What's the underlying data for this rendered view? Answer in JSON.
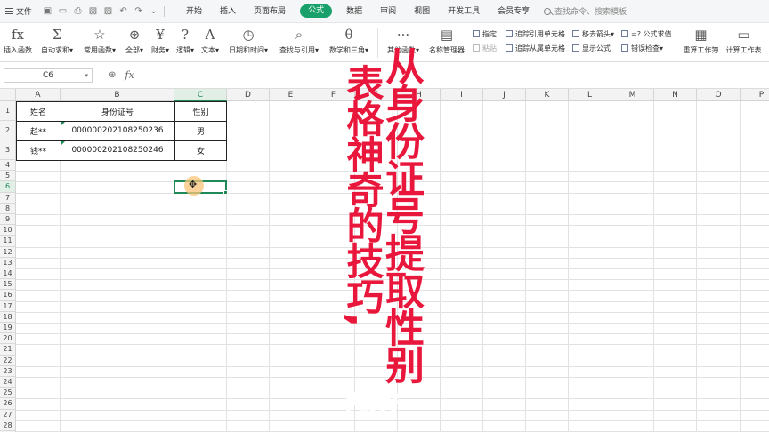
{
  "menu": {
    "file_label": "文件",
    "tabs": [
      "开始",
      "插入",
      "页面布局",
      "公式",
      "数据",
      "审阅",
      "视图",
      "开发工具",
      "会员专享"
    ],
    "active_tab": "公式",
    "search_placeholder": "查找命令、搜索模板"
  },
  "ribbon": {
    "buttons": [
      {
        "icon": "fx",
        "label": "插入函数"
      },
      {
        "icon": "Σ",
        "label": "自动求和▾"
      },
      {
        "icon": "☆",
        "label": "常用函数▾"
      },
      {
        "icon": "⊛",
        "label": "全部▾"
      },
      {
        "icon": "¥",
        "label": "财务▾"
      },
      {
        "icon": "?",
        "label": "逻辑▾"
      },
      {
        "icon": "A",
        "label": "文本▾"
      },
      {
        "icon": "◷",
        "label": "日期和时间▾"
      },
      {
        "icon": "⌕",
        "label": "查找与引用▾"
      },
      {
        "icon": "θ",
        "label": "数学和三角▾"
      },
      {
        "icon": "···",
        "label": "其他函数▾"
      },
      {
        "icon": "▤",
        "label": "名称管理器"
      }
    ],
    "group1": [
      "指定",
      "粘贴"
    ],
    "group2": [
      "追踪引用单元格",
      "追踪从属单元格"
    ],
    "group3": [
      "移去箭头▾",
      "显示公式"
    ],
    "group4": [
      "=? 公式求值",
      "错误检查▾"
    ],
    "right_buttons": [
      {
        "icon": "▦",
        "label": "重算工作簿"
      },
      {
        "icon": "▭",
        "label": "计算工作表"
      }
    ]
  },
  "formula_bar": {
    "name_box": "C6",
    "fx_label": "fx",
    "value": ""
  },
  "sheet": {
    "columns": [
      "A",
      "B",
      "C",
      "D",
      "E",
      "F",
      "G",
      "H",
      "I",
      "J",
      "K",
      "L",
      "M",
      "N",
      "O",
      "P"
    ],
    "selected_column": "C",
    "selected_row": "6",
    "row_count": 30,
    "table": {
      "headers": [
        "姓名",
        "身份证号",
        "性别"
      ],
      "rows": [
        [
          "赵**",
          "000000202108250236",
          "男"
        ],
        [
          "钱**",
          "000000202108250246",
          "女"
        ]
      ]
    }
  },
  "overlay": {
    "line1": "表格神奇的技巧,",
    "line2": "从身份证号提取性别",
    "greeting": "大家好"
  }
}
